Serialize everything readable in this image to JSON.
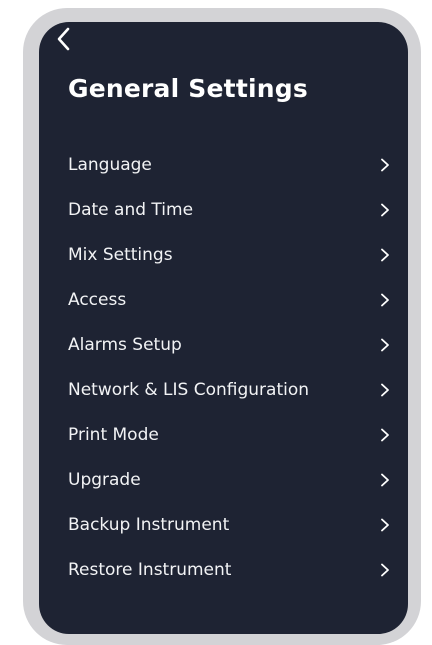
{
  "header": {
    "back_icon": "chevron-left-icon",
    "title": "General Settings"
  },
  "menu": {
    "chevron_icon": "chevron-right-icon",
    "items": [
      {
        "label": "Language"
      },
      {
        "label": "Date and Time"
      },
      {
        "label": "Mix Settings"
      },
      {
        "label": "Access"
      },
      {
        "label": "Alarms Setup"
      },
      {
        "label": "Network & LIS Configuration"
      },
      {
        "label": "Print Mode"
      },
      {
        "label": "Upgrade"
      },
      {
        "label": "Backup Instrument"
      },
      {
        "label": "Restore Instrument"
      }
    ]
  },
  "colors": {
    "frame": "#d3d3d6",
    "screen_background": "#1e2333",
    "text": "#ffffff"
  }
}
